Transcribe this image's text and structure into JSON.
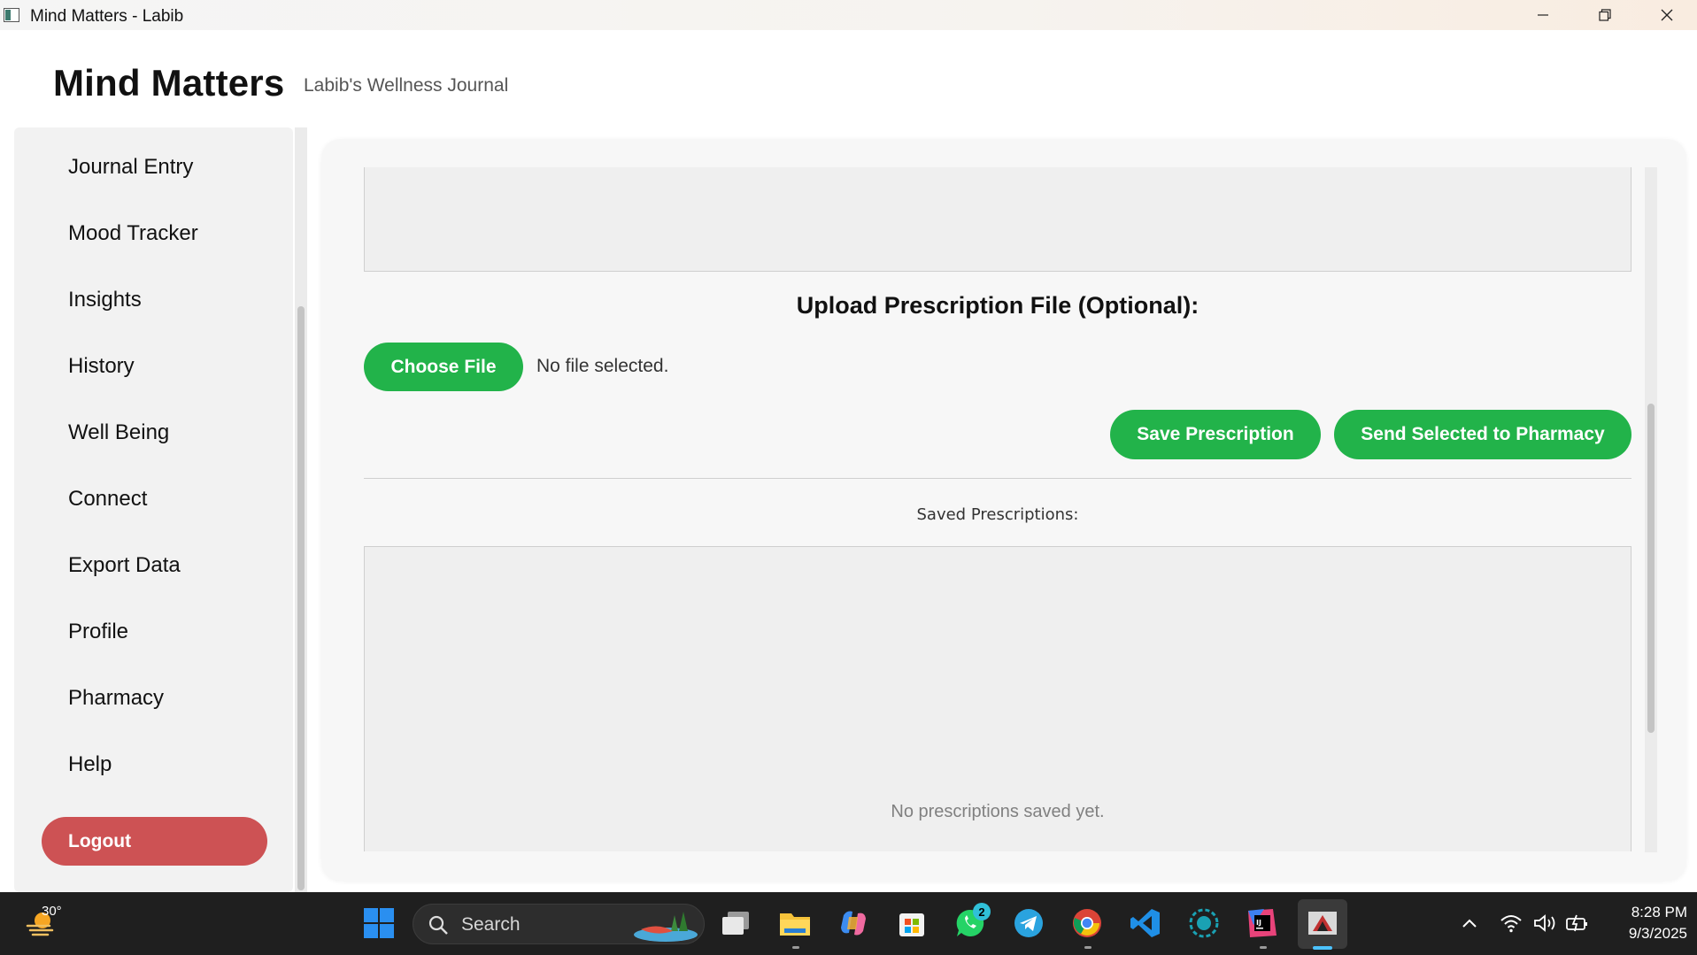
{
  "window": {
    "title": "Mind Matters - Labib",
    "controls": [
      "minimize",
      "maximize",
      "close"
    ]
  },
  "header": {
    "brand": "Mind Matters",
    "tagline": "Labib's Wellness Journal"
  },
  "sidebar": {
    "items": [
      {
        "label": "Journal Entry"
      },
      {
        "label": "Mood Tracker"
      },
      {
        "label": "Insights"
      },
      {
        "label": "History"
      },
      {
        "label": "Well Being"
      },
      {
        "label": "Connect"
      },
      {
        "label": "Export Data"
      },
      {
        "label": "Profile"
      },
      {
        "label": "Pharmacy"
      },
      {
        "label": "Help"
      }
    ],
    "logout_label": "Logout"
  },
  "main": {
    "upload_title": "Upload Prescription File (Optional):",
    "choose_file_label": "Choose File",
    "file_status": "No file selected.",
    "save_button": "Save Prescription",
    "send_button": "Send Selected to Pharmacy",
    "saved_label": "Saved Prescriptions:",
    "empty_message": "No prescriptions saved yet."
  },
  "colors": {
    "accent_green": "#22b34a",
    "logout_red": "#cd5254"
  },
  "taskbar": {
    "weather_temp": "30°",
    "search_placeholder": "Search",
    "whatsapp_badge": "2",
    "time": "8:28 PM",
    "date": "9/3/2025",
    "icons": [
      "weather-icon",
      "start-icon",
      "search-icon",
      "task-view-icon",
      "file-explorer-icon",
      "copilot-icon",
      "store-icon",
      "whatsapp-icon",
      "telegram-icon",
      "chrome-icon",
      "vscode-icon",
      "app-icon",
      "intellij-icon",
      "java-app-icon",
      "chevron-up-icon",
      "wifi-icon",
      "volume-icon",
      "battery-icon"
    ]
  }
}
